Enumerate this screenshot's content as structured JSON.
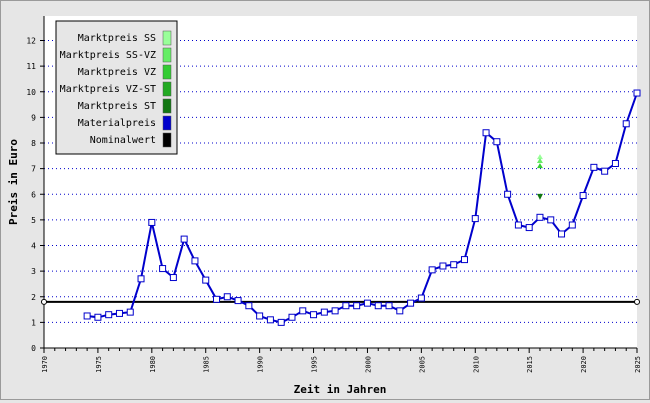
{
  "chart_data": {
    "type": "line",
    "xlabel": "Zeit in Jahren",
    "ylabel": "Preis in Euro",
    "xlim": [
      1970,
      2025
    ],
    "ylim": [
      0,
      13
    ],
    "grid": {
      "horizontal": true,
      "style": "dotted",
      "color": "#0000cc"
    },
    "x_ticks": [
      1970,
      1975,
      1980,
      1985,
      1990,
      1995,
      2000,
      2005,
      2010,
      2015,
      2020,
      2025
    ],
    "y_ticks": [
      0,
      1,
      2,
      3,
      4,
      5,
      6,
      7,
      8,
      9,
      10,
      11,
      12
    ],
    "legend": {
      "position": "top-left",
      "items": [
        {
          "label": "Marktpreis SS",
          "color": "#99ff99"
        },
        {
          "label": "Marktpreis SS-VZ",
          "color": "#66ee66"
        },
        {
          "label": "Marktpreis VZ",
          "color": "#33cc33"
        },
        {
          "label": "Marktpreis VZ-ST",
          "color": "#22aa22"
        },
        {
          "label": "Marktpreis ST",
          "color": "#117711"
        },
        {
          "label": "Materialpreis",
          "color": "#0000cc"
        },
        {
          "label": "Nominalwert",
          "color": "#000000"
        }
      ]
    },
    "series": [
      {
        "name": "Materialpreis",
        "color": "#0000cc",
        "marker": "square",
        "x": [
          1974,
          1975,
          1976,
          1977,
          1978,
          1979,
          1980,
          1981,
          1982,
          1983,
          1984,
          1985,
          1986,
          1987,
          1988,
          1989,
          1990,
          1991,
          1992,
          1993,
          1994,
          1995,
          1996,
          1997,
          1998,
          1999,
          2000,
          2001,
          2002,
          2003,
          2004,
          2005,
          2006,
          2007,
          2008,
          2009,
          2010,
          2011,
          2012,
          2013,
          2014,
          2015,
          2016,
          2017,
          2018,
          2019,
          2020,
          2021,
          2022,
          2023,
          2024,
          2025
        ],
        "y": [
          1.25,
          1.2,
          1.3,
          1.35,
          1.4,
          2.7,
          4.9,
          3.1,
          2.75,
          4.25,
          3.4,
          2.65,
          1.9,
          2.0,
          1.85,
          1.65,
          1.25,
          1.1,
          1.0,
          1.2,
          1.45,
          1.3,
          1.4,
          1.45,
          1.65,
          1.65,
          1.75,
          1.65,
          1.65,
          1.45,
          1.75,
          1.95,
          3.05,
          3.2,
          3.25,
          3.45,
          5.05,
          8.4,
          8.05,
          6.0,
          4.8,
          4.7,
          5.1,
          5.0,
          4.45,
          4.8,
          5.95,
          7.05,
          6.9,
          7.2,
          8.75,
          9.95
        ]
      },
      {
        "name": "Nominalwert",
        "color": "#000000",
        "x": [
          1970,
          2025
        ],
        "y": [
          1.8,
          1.8
        ]
      }
    ],
    "market_points": [
      {
        "series": "Marktpreis SS",
        "color": "#99ff99",
        "x": 2016,
        "y": 7.45
      },
      {
        "series": "Marktpreis SS-VZ",
        "color": "#66ee66",
        "x": 2016,
        "y": 7.3
      },
      {
        "series": "Marktpreis VZ",
        "color": "#33cc33",
        "x": 2016,
        "y": 7.1
      },
      {
        "series": "Marktpreis ST",
        "color": "#117711",
        "x": 2016,
        "y": 5.9
      }
    ]
  }
}
